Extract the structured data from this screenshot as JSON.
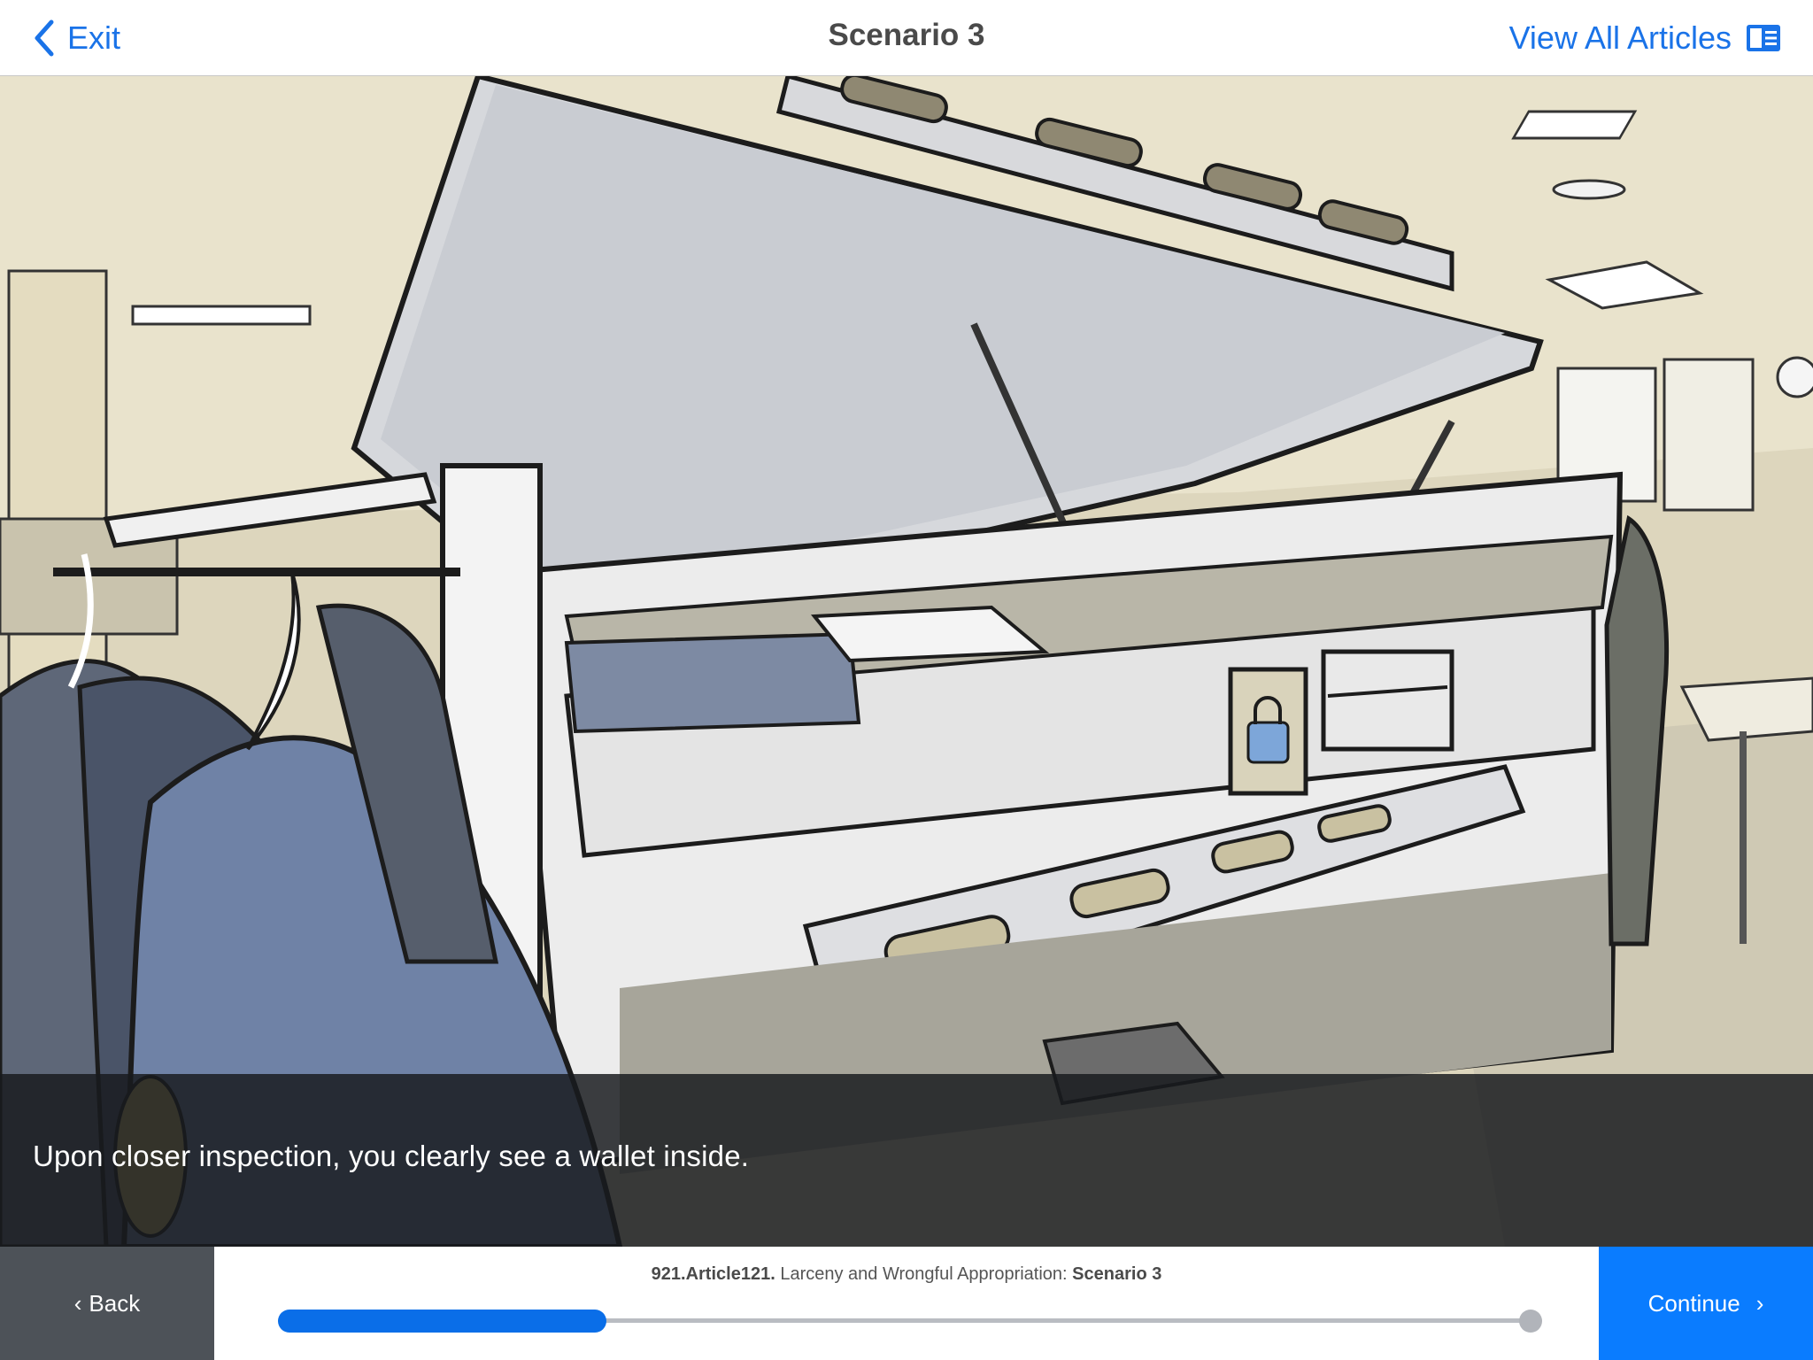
{
  "header": {
    "exit_label": "Exit",
    "title": "Scenario 3",
    "articles_label": "View All Articles",
    "exit_icon": "chevron-left-icon",
    "articles_icon": "article-list-icon"
  },
  "scene": {
    "caption": "Upon closer inspection, you clearly see a wallet inside."
  },
  "footer": {
    "back_label": "Back",
    "continue_label": "Continue",
    "article_id": "921.Article121.",
    "article_title": "Larceny and Wrongful Appropriation:",
    "article_scenario": "Scenario 3",
    "progress": 0.26
  },
  "colors": {
    "accent": "#1a73e8",
    "continue_bg": "#0a7cff",
    "back_bg": "#4d5258",
    "progress_fill": "#0a6ee8",
    "progress_track": "#b9bcc2"
  }
}
